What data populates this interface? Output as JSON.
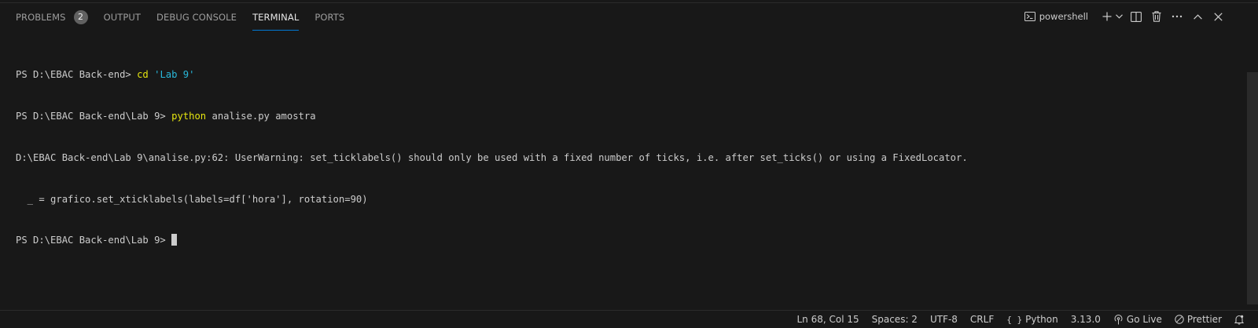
{
  "panel": {
    "tabs": [
      {
        "label": "PROBLEMS",
        "badge": "2"
      },
      {
        "label": "OUTPUT"
      },
      {
        "label": "DEBUG CONSOLE"
      },
      {
        "label": "TERMINAL"
      },
      {
        "label": "PORTS"
      }
    ],
    "active_tab": "TERMINAL",
    "shell_name": "powershell",
    "action_icons": [
      "terminal-icon",
      "plus-icon",
      "chevron-down-icon",
      "split-icon",
      "trash-icon",
      "more-icon",
      "chevron-up-icon",
      "close-icon"
    ]
  },
  "terminal": {
    "lines": [
      {
        "prompt": "PS D:\\EBAC Back-end> ",
        "cmd": "cd",
        "arg": " ",
        "str": "'Lab 9'"
      },
      {
        "prompt": "PS D:\\EBAC Back-end\\Lab 9> ",
        "cmd": "python",
        "arg": " analise.py amostra"
      },
      {
        "text": "D:\\EBAC Back-end\\Lab 9\\analise.py:62: UserWarning: set_ticklabels() should only be used with a fixed number of ticks, i.e. after set_ticks() or using a FixedLocator."
      },
      {
        "text": "  _ = grafico.set_xticklabels(labels=df['hora'], rotation=90)"
      },
      {
        "prompt": "PS D:\\EBAC Back-end\\Lab 9> "
      }
    ]
  },
  "status_bar": {
    "position": "Ln 68, Col 15",
    "spaces": "Spaces: 2",
    "encoding": "UTF-8",
    "eol": "CRLF",
    "language": "Python",
    "language_icon": "{ }",
    "python_version": "3.13.0",
    "go_live": "Go Live",
    "prettier": "Prettier"
  },
  "colors": {
    "background": "#181818",
    "accent": "#0078d4",
    "command": "#e5e510",
    "string": "#29b8db"
  }
}
